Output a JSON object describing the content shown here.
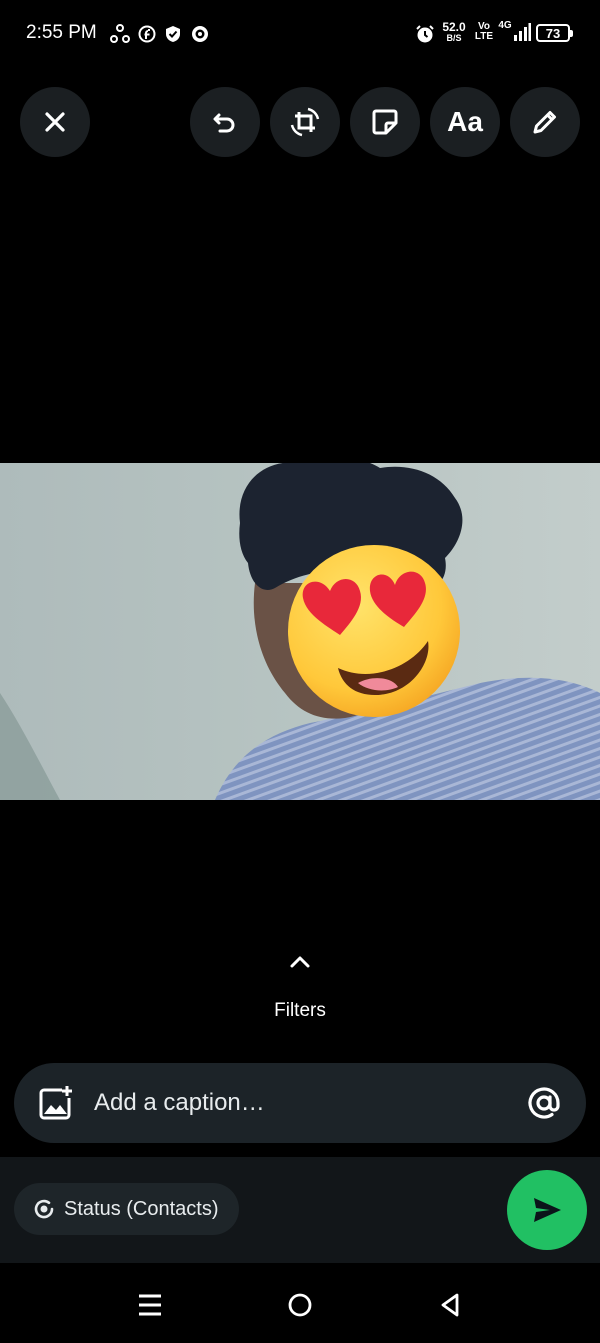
{
  "status_bar": {
    "time": "2:55 PM",
    "network_speed_value": "52.0",
    "network_speed_unit": "B/S",
    "volte_top": "Vo",
    "volte_bottom": "LTE",
    "network_type": "4G",
    "battery_level": "73",
    "icons": [
      "sync-icon",
      "facebook-icon",
      "shield-icon",
      "target-icon",
      "alarm-icon",
      "signal-icon"
    ]
  },
  "toolbar": {
    "close_icon": "close-icon",
    "undo_icon": "undo-icon",
    "crop_rotate_icon": "crop-rotate-icon",
    "sticker_icon": "sticker-icon",
    "text_tool_label": "Aa",
    "draw_icon": "pencil-icon"
  },
  "editor": {
    "filters_label": "Filters",
    "filters_icon": "chevron-up-icon"
  },
  "caption": {
    "placeholder": "Add a caption…",
    "add_media_icon": "add-image-icon",
    "mention_icon": "at-icon"
  },
  "audience": {
    "label": "Status (Contacts)",
    "icon": "status-icon"
  },
  "send": {
    "icon": "send-icon",
    "color": "#21c063"
  },
  "nav": {
    "icons": [
      "menu-icon",
      "home-icon",
      "back-icon"
    ]
  },
  "colors": {
    "background": "#000000",
    "caption_bar": "#1c2328",
    "accent": "#21c063"
  }
}
